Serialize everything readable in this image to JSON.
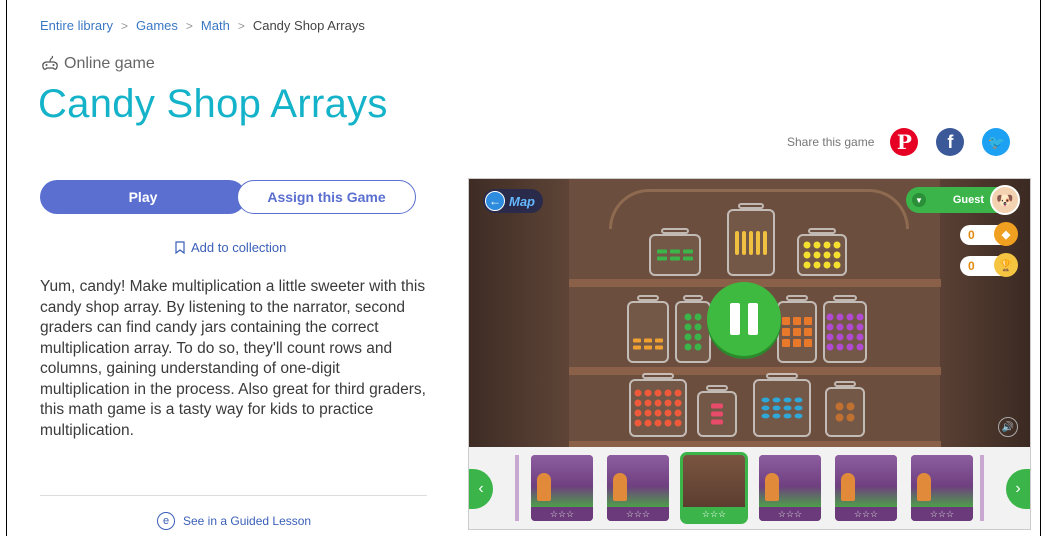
{
  "breadcrumb": {
    "items": [
      "Entire library",
      "Games",
      "Math"
    ],
    "current": "Candy Shop Arrays",
    "separator": ">"
  },
  "page": {
    "type_label": "Online game",
    "title": "Candy Shop Arrays"
  },
  "share": {
    "label": "Share this game",
    "icons": [
      "pinterest-icon",
      "facebook-icon",
      "twitter-icon"
    ],
    "pinterest_glyph": "P",
    "facebook_glyph": "f",
    "twitter_glyph": "🐦"
  },
  "actions": {
    "play_label": "Play",
    "assign_label": "Assign this Game",
    "add_collection_label": "Add to collection"
  },
  "description": "Yum, candy! Make multiplication a little sweeter with this candy shop array. By listening to the narrator, second graders can find candy jars containing the correct multiplication array. To do so, they'll count rows and columns, gaining understanding of one-digit multiplication in the process. Also great for third graders, this math game is a tasty way for kids to practice multiplication.",
  "guided": {
    "label": "See in a Guided Lesson"
  },
  "game": {
    "map_label": "Map",
    "user_name": "Guest",
    "coins": "0",
    "trophies": "0",
    "thumb_stars": "☆☆☆",
    "active_thumb_index": 2,
    "thumb_count": 6
  },
  "colors": {
    "title": "#14b3c9",
    "primary": "#5a6fd0",
    "game_green": "#3bb54a"
  }
}
